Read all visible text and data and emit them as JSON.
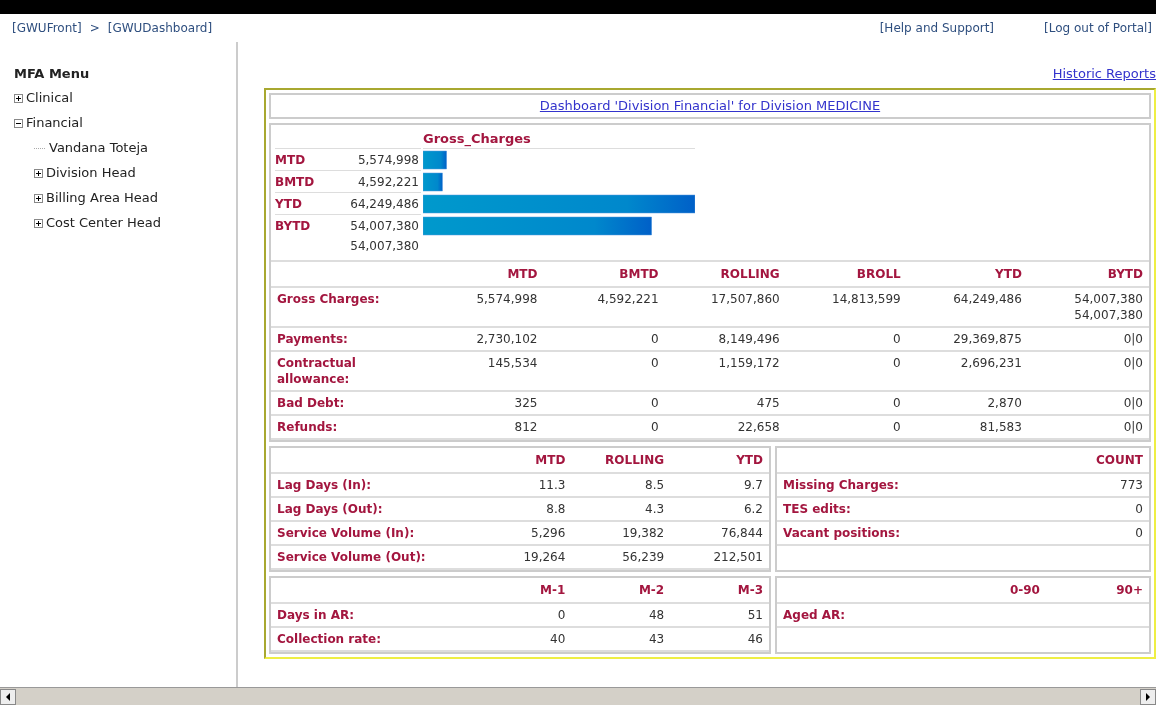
{
  "breadcrumb": {
    "items": [
      "[GWUFront]",
      "[GWUDashboard]"
    ],
    "separator": ">"
  },
  "top_links": [
    "[Help and Support]",
    "[Log out of Portal]"
  ],
  "sidebar": {
    "title": "MFA Menu",
    "items": [
      {
        "label": "Clinical",
        "kind": "folder",
        "expanded": false
      },
      {
        "label": "Financial",
        "kind": "folder",
        "expanded": true,
        "children": [
          {
            "label": "Vandana Toteja",
            "kind": "leaf"
          },
          {
            "label": "Division Head",
            "kind": "folder",
            "expanded": false
          },
          {
            "label": "Billing Area Head",
            "kind": "folder",
            "expanded": false
          },
          {
            "label": "Cost Center Head",
            "kind": "folder",
            "expanded": false
          }
        ]
      }
    ]
  },
  "historic_link": "Historic Reports",
  "dashboard": {
    "title": "Dashboard 'Division Financial' for Division MEDICINE",
    "chart_data": {
      "type": "bar",
      "orientation": "horizontal",
      "title": "Gross_Charges",
      "categories": [
        "MTD",
        "BMTD",
        "YTD",
        "BYTD"
      ],
      "values": [
        5574998,
        4592221,
        64249486,
        54007380
      ],
      "data_labels": true,
      "value_labels": [
        "5,574,998",
        "4,592,221",
        "64,249,486",
        "54,007,380"
      ]
    },
    "chart_note": "54,007,380",
    "financial_table": {
      "columns": [
        "MTD",
        "BMTD",
        "ROLLING",
        "BROLL",
        "YTD",
        "BYTD"
      ],
      "rows": [
        {
          "label": "Gross Charges:",
          "cells": [
            "5,574,998",
            "4,592,221",
            "17,507,860",
            "14,813,599",
            "64,249,486",
            "54,007,380\n54,007,380"
          ]
        },
        {
          "label": "Payments:",
          "cells": [
            "2,730,102",
            "0",
            "8,149,496",
            "0",
            "29,369,875",
            "0|0"
          ]
        },
        {
          "label": "Contractual allowance:",
          "cells": [
            "145,534",
            "0",
            "1,159,172",
            "0",
            "2,696,231",
            "0|0"
          ]
        },
        {
          "label": "Bad Debt:",
          "cells": [
            "325",
            "0",
            "475",
            "0",
            "2,870",
            "0|0"
          ]
        },
        {
          "label": "Refunds:",
          "cells": [
            "812",
            "0",
            "22,658",
            "0",
            "81,583",
            "0|0"
          ]
        }
      ]
    },
    "volume_table": {
      "columns": [
        "MTD",
        "ROLLING",
        "YTD"
      ],
      "rows": [
        {
          "label": "Lag Days (In):",
          "cells": [
            "11.3",
            "8.5",
            "9.7"
          ]
        },
        {
          "label": "Lag Days (Out):",
          "cells": [
            "8.8",
            "4.3",
            "6.2"
          ]
        },
        {
          "label": "Service Volume (In):",
          "cells": [
            "5,296",
            "19,382",
            "76,844"
          ]
        },
        {
          "label": "Service Volume (Out):",
          "cells": [
            "19,264",
            "56,239",
            "212,501"
          ]
        }
      ]
    },
    "count_table": {
      "columns": [
        "COUNT"
      ],
      "rows": [
        {
          "label": "Missing Charges:",
          "cells": [
            "773"
          ]
        },
        {
          "label": "TES edits:",
          "cells": [
            "0"
          ]
        },
        {
          "label": "Vacant positions:",
          "cells": [
            "0"
          ]
        }
      ]
    },
    "ar_table": {
      "columns": [
        "M-1",
        "M-2",
        "M-3"
      ],
      "rows": [
        {
          "label": "Days in AR:",
          "cells": [
            "0",
            "48",
            "51"
          ]
        },
        {
          "label": "Collection rate:",
          "cells": [
            "40",
            "43",
            "46"
          ]
        }
      ]
    },
    "aged_table": {
      "columns": [
        "0-90",
        "90+"
      ],
      "rows": [
        {
          "label": "Aged AR:",
          "cells": []
        }
      ]
    }
  }
}
